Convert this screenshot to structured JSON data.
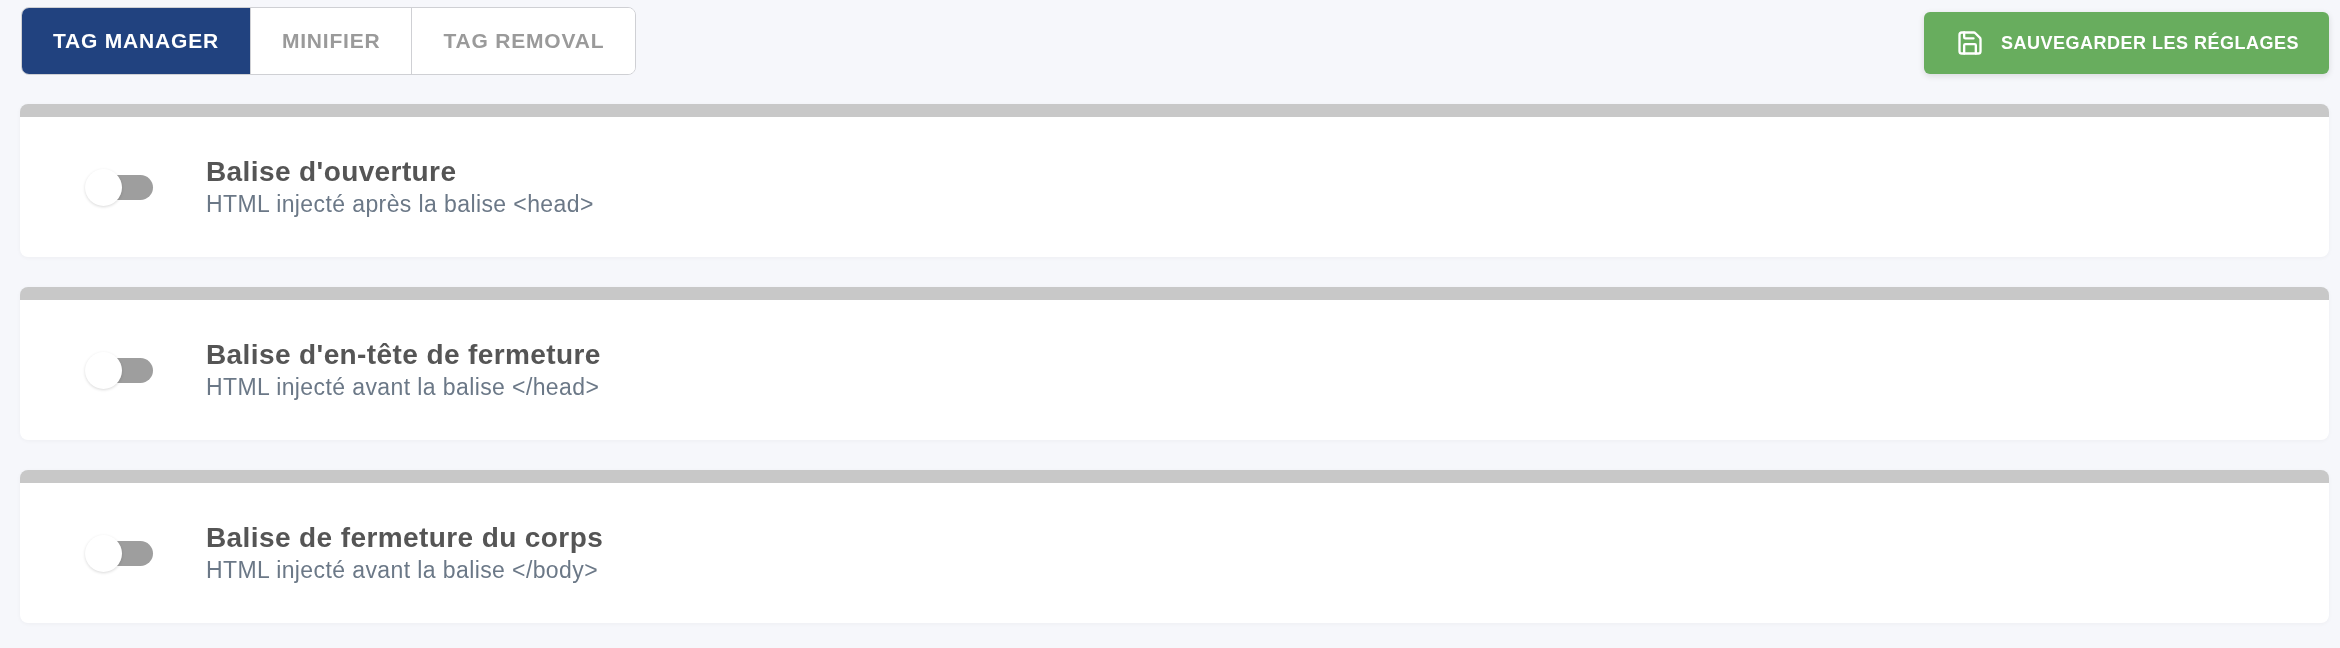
{
  "tabs": [
    {
      "label": "TAG MANAGER",
      "selected": true
    },
    {
      "label": "MINIFIER",
      "selected": false
    },
    {
      "label": "TAG REMOVAL",
      "selected": false
    }
  ],
  "save_button": {
    "label": "SAUVEGARDER LES RÉGLAGES"
  },
  "settings": [
    {
      "title": "Balise d'ouverture",
      "description": "HTML injecté après la balise <head>",
      "on": false
    },
    {
      "title": "Balise d'en-tête de fermeture",
      "description": "HTML injecté avant la balise </head>",
      "on": false
    },
    {
      "title": "Balise de fermeture du corps",
      "description": "HTML injecté avant la balise </body>",
      "on": false
    }
  ]
}
